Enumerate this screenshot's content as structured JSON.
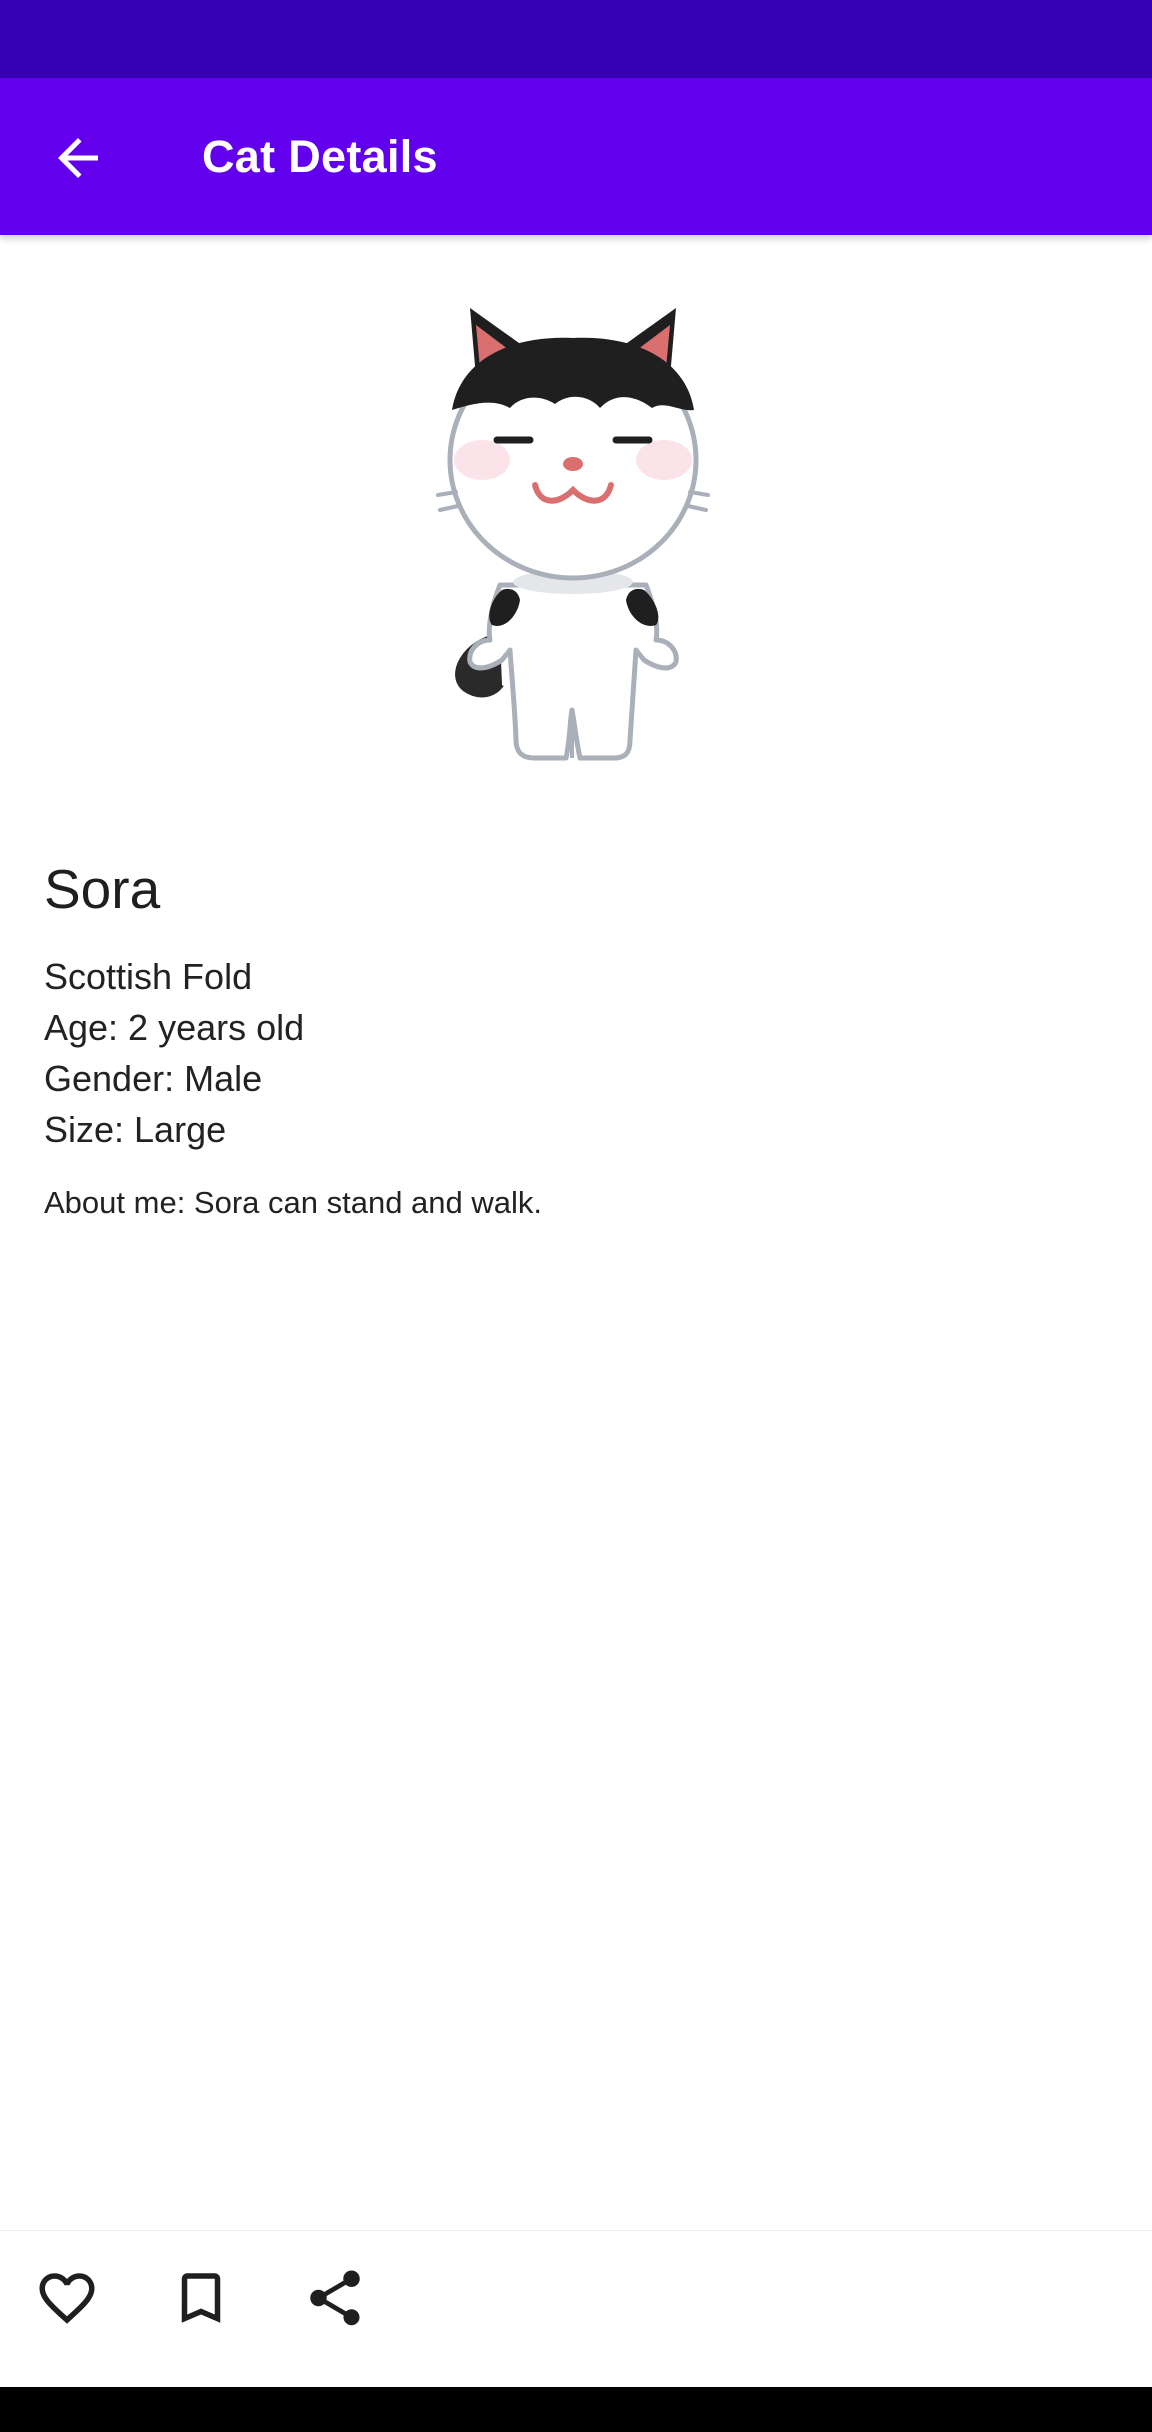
{
  "app_bar": {
    "title": "Cat Details",
    "back_icon": "arrow-back-icon"
  },
  "cat": {
    "image_alt": "Cartoon of a standing white cat with black patches",
    "name": "Sora",
    "breed": "Scottish Fold",
    "age": "Age: 2 years old",
    "gender": "Gender: Male",
    "size": "Size: Large",
    "about": "About me: Sora can stand and walk."
  },
  "actions": {
    "favorite_icon": "heart-outline-icon",
    "bookmark_icon": "bookmark-outline-icon",
    "share_icon": "share-icon"
  },
  "colors": {
    "status_bar": "#3700B3",
    "app_bar": "#6200EE",
    "title_text": "#FFFFFF",
    "body_text": "#222222"
  }
}
